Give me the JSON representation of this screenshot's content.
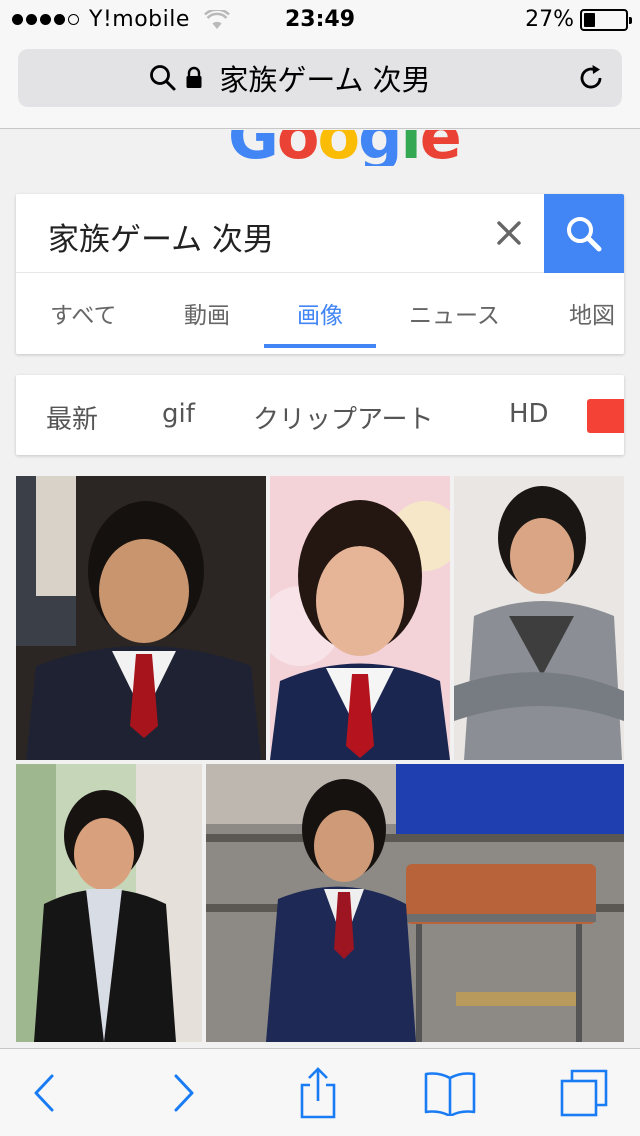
{
  "status_bar": {
    "carrier": "Y!mobile",
    "time": "23:49",
    "battery_percent": "27%",
    "battery_level": 0.27,
    "signal_bars_filled": 4
  },
  "url_bar": {
    "text": "家族ゲーム 次男"
  },
  "logo": {
    "letters": [
      "G",
      "o",
      "o",
      "g",
      "l",
      "e"
    ],
    "colors": [
      "#4285f4",
      "#ea4335",
      "#fbbc05",
      "#4285f4",
      "#34a853",
      "#ea4335"
    ]
  },
  "search": {
    "query": "家族ゲーム 次男",
    "accent_color": "#4285f4"
  },
  "tabs": [
    "すべて",
    "動画",
    "画像",
    "ニュース",
    "地図"
  ],
  "active_tab": "画像",
  "chips": [
    "最新",
    "gif",
    "クリップアート",
    "HD"
  ],
  "icons": [
    "search-icon",
    "lock-icon",
    "reload-icon",
    "clear-icon",
    "back-icon",
    "forward-icon",
    "share-icon",
    "bookmarks-icon",
    "tabs-icon"
  ]
}
